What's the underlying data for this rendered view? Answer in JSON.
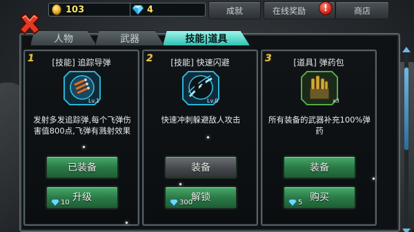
{
  "topbar": {
    "gold": "103",
    "gems": "4",
    "achievements_label": "成就",
    "online_reward_label": "在线奖励",
    "alert_mark": "!",
    "shop_label": "商店"
  },
  "tabs": [
    {
      "label": "人物",
      "active": false
    },
    {
      "label": "武器",
      "active": false
    },
    {
      "label": "技能|道具",
      "active": true
    }
  ],
  "cards": [
    {
      "index": "1",
      "title": "[技能] 追踪导弹",
      "icon": "missile-icon",
      "level": "Lv.1",
      "description": "发射多发追踪弹,每个飞弹伤害值800点,飞弹有溅射效果",
      "primary_button": "已装备",
      "primary_style": "green",
      "secondary_button": "升级",
      "price": "10"
    },
    {
      "index": "2",
      "title": "[技能] 快速闪避",
      "icon": "dodge-icon",
      "level": "Lv.0",
      "description": "快速冲刺躲避敌人攻击",
      "primary_button": "装备",
      "primary_style": "gray",
      "secondary_button": "解锁",
      "price": "300"
    },
    {
      "index": "3",
      "title": "[道具] 弹药包",
      "icon": "ammo-pack-icon",
      "level": "x3",
      "description": "所有装备的武器补充100%弹药",
      "primary_button": "装备",
      "primary_style": "green",
      "secondary_button": "购买",
      "price": "5"
    }
  ],
  "colors": {
    "accent_tab": "#2fc2b3",
    "button_green": "#2b7a47",
    "gold_text": "#ffe36a"
  }
}
